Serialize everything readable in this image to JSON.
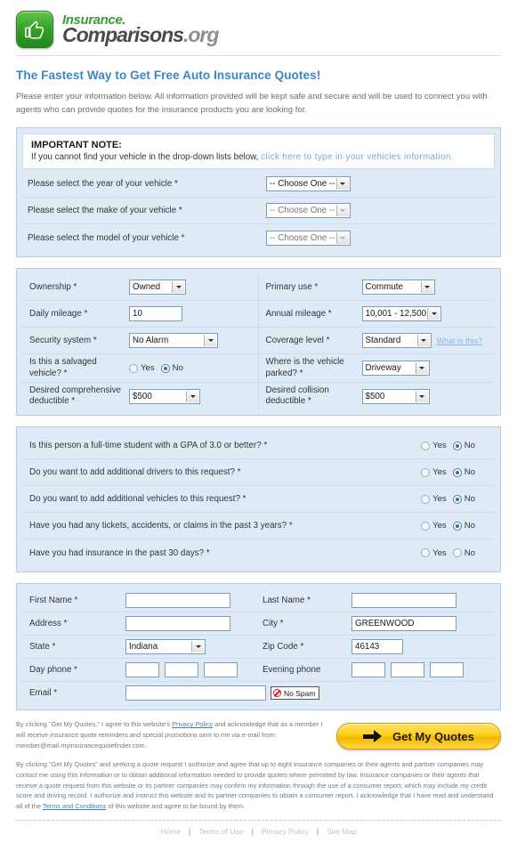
{
  "brand": {
    "line1": "Insurance.",
    "line2_main": "Comparisons",
    "line2_tld": ".org",
    "logo_icon": "thumbs-up-icon"
  },
  "header": {
    "title": "The Fastest Way to Get Free Auto Insurance Quotes!",
    "intro": "Please enter your information below. All information provided will be kept safe and secure and will be used to connect you with agents who can provide quotes for the insurance products you are looking for."
  },
  "note": {
    "title": "IMPORTANT NOTE:",
    "text_before": "If you cannot find your vehicle in the drop-down lists below, ",
    "link": "click here to type in your vehicles information."
  },
  "vehicle": {
    "rows": [
      {
        "label": "Please select the year of your vehicle *",
        "value": "-- Choose One --",
        "disabled": false
      },
      {
        "label": "Please select the make of your vehicle *",
        "value": "-- Choose One --",
        "disabled": true
      },
      {
        "label": "Please select the model of your vehicle *",
        "value": "-- Choose One --",
        "disabled": true
      }
    ]
  },
  "details": {
    "left": {
      "ownership": {
        "label": "Ownership *",
        "value": "Owned"
      },
      "daily_mileage": {
        "label": "Daily mileage *",
        "value": "10"
      },
      "security_system": {
        "label": "Security system *",
        "value": "No Alarm"
      },
      "salvaged": {
        "label": "Is this a salvaged vehicle? *",
        "yes": "Yes",
        "no": "No",
        "selected": "No"
      },
      "comprehensive": {
        "label": "Desired comprehensive deductible *",
        "value": "$500"
      }
    },
    "right": {
      "primary_use": {
        "label": "Primary use *",
        "value": "Commute"
      },
      "annual_mileage": {
        "label": "Annual mileage *",
        "value": "10,001 - 12,500"
      },
      "coverage_level": {
        "label": "Coverage level *",
        "value": "Standard",
        "help": "What is this?"
      },
      "parked": {
        "label": "Where is the vehicle parked? *",
        "value": "Driveway"
      },
      "collision": {
        "label": "Desired collision deductible *",
        "value": "$500"
      }
    }
  },
  "questions": {
    "yes_label": "Yes",
    "no_label": "No",
    "items": [
      {
        "label": "Is this person a full-time student with a GPA of 3.0 or better? *",
        "selected": "No"
      },
      {
        "label": "Do you want to add additional drivers to this request? *",
        "selected": "No"
      },
      {
        "label": "Do you want to add additional vehicles to this request? *",
        "selected": "No"
      },
      {
        "label": "Have you had any tickets, accidents, or claims in the past 3 years? *",
        "selected": "No"
      },
      {
        "label": "Have you had insurance in the past 30 days? *",
        "selected": ""
      }
    ]
  },
  "personal": {
    "first_name": {
      "label": "First Name *",
      "value": ""
    },
    "last_name": {
      "label": "Last Name *",
      "value": ""
    },
    "address": {
      "label": "Address *",
      "value": ""
    },
    "city": {
      "label": "City *",
      "value": "GREENWOOD"
    },
    "state": {
      "label": "State *",
      "value": "Indiana"
    },
    "zip": {
      "label": "Zip Code *",
      "value": "46143"
    },
    "day_phone": {
      "label": "Day phone *",
      "p1": "",
      "p2": "",
      "p3": ""
    },
    "evening_phone": {
      "label": "Evening phone",
      "p1": "",
      "p2": "",
      "p3": ""
    },
    "email": {
      "label": "Email *",
      "value": "",
      "badge": "No Spam",
      "badge_icon": "no-spam-icon"
    }
  },
  "legal": {
    "p1_a": "By clicking \"Get My Quotes,\" I agree to this website's ",
    "p1_link": "Privacy Policy",
    "p1_b": " and acknowledge that as a member I will receive insurance quote reminders and special promotions sent to me via e-mail from: member@mail.myinsurancequotefinder.com.",
    "p2_a": "By clicking \"Get My Quotes\" and seeking a quote request I authorize and agree that up to eight insurance companies or their agents and partner companies may contact me using this information or to obtain additional information needed to provide quotes where permitted by law. Insurance companies or their agents that receive a quote request from this website or its partner companies may confirm my information through the use of a consumer report, which may include my credit score and driving record. I authorize and instruct this website and its partner companies to obtain a consumer report. I acknowledge that I have read and understand all of the ",
    "p2_link": "Terms and Conditions",
    "p2_b": " of this website and agree to be bound by them.",
    "submit_label": "Get My Quotes",
    "submit_icon": "arrow-right-icon"
  },
  "footer": {
    "links": [
      "Home",
      "Terms of Use",
      "Privacy Policy",
      "Site Map"
    ],
    "separator": "|"
  },
  "colors": {
    "accent_blue": "#3b85c8",
    "panel_bg": "#dfeaf7",
    "panel_border": "#b3cce4",
    "brand_green": "#3d9b35",
    "button_yellow": "#ffcf1a"
  }
}
